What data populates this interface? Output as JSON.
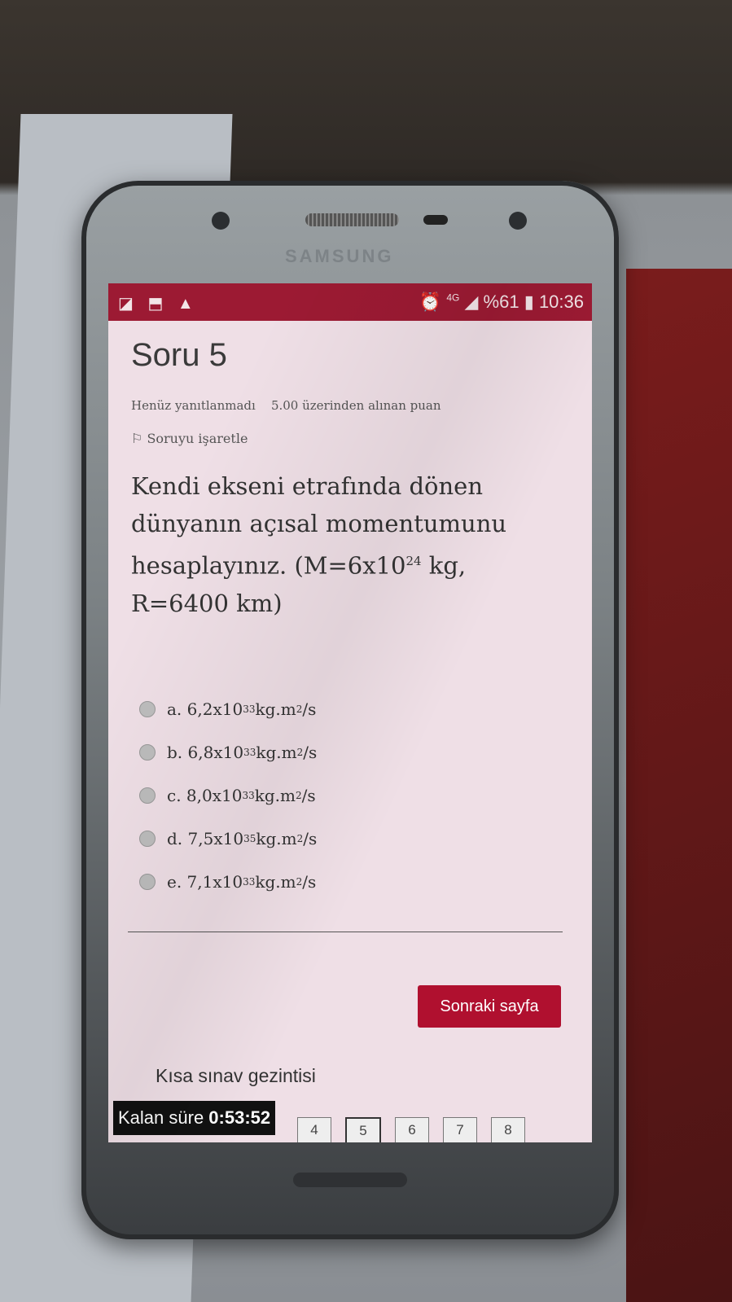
{
  "device": {
    "brand": "SAMSUNG"
  },
  "status_bar": {
    "left_icons": "◪ ⬒ ▲",
    "battery": "%61",
    "time": "10:36",
    "network": "4G"
  },
  "question": {
    "title": "Soru 5",
    "status": "Henüz yanıtlanmadı",
    "points": "5.00 üzerinden alınan puan",
    "flag_label": "Soruyu işaretle",
    "text_part1": "Kendi ekseni etrafında dönen dünyanın açısal momentumunu hesaplayınız. (M=6x10",
    "text_exp": "24",
    "text_part2": " kg, R=6400 km)"
  },
  "answers": [
    {
      "prefix": "a. 6,2x10",
      "exp": "33",
      "unit": " kg.m",
      "unit_exp": "2",
      "unit_tail": "/s"
    },
    {
      "prefix": "b. 6,8x10",
      "exp": "33",
      "unit": " kg.m",
      "unit_exp": "2",
      "unit_tail": "/s"
    },
    {
      "prefix": "c. 8,0x10",
      "exp": "33",
      "unit": " kg.m",
      "unit_exp": "2",
      "unit_tail": "/s"
    },
    {
      "prefix": "d. 7,5x10",
      "exp": "35",
      "unit": " kg.m",
      "unit_exp": "2",
      "unit_tail": "/s"
    },
    {
      "prefix": "e. 7,1x10",
      "exp": "33",
      "unit": " kg.m",
      "unit_exp": "2",
      "unit_tail": "/s"
    }
  ],
  "next_button": "Sonraki sayfa",
  "nav_title": "Kısa sınav gezintisi",
  "timer": {
    "label": "Kalan süre ",
    "value": "0:53:52"
  },
  "pages": [
    "4",
    "5",
    "6",
    "7",
    "8"
  ],
  "colors": {
    "accent": "#b0102f",
    "status_bar": "#9c1a33"
  }
}
